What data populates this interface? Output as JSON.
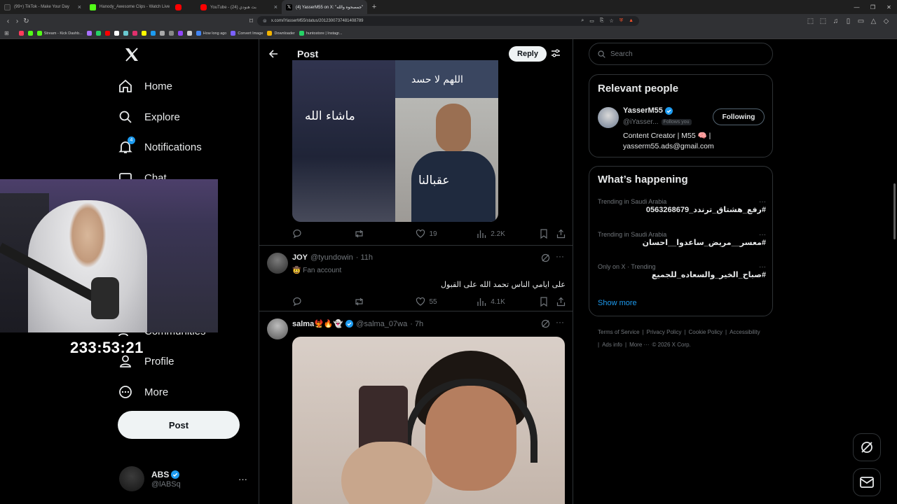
{
  "browser": {
    "tabs": [
      {
        "title": "(99+) TikTok - Make Your Day",
        "color": "#2b2b2b"
      },
      {
        "title": "Hanody_Awesome Clips - Watch Live",
        "color": "#53fc18"
      },
      {
        "title": "",
        "color": "#ff0000"
      },
      {
        "title": "YouTube - (24) بث هنودي",
        "color": "#ff0000"
      },
      {
        "title": "(4) YasserM55 on X: \"جمصحوه والله\"",
        "color": "#000000",
        "active": true
      }
    ],
    "new_tab": "+",
    "url": "x.com/iYasserM55/status/2012300737481408789",
    "bookmarks": [
      {
        "label": "",
        "color": "#ff3b5c"
      },
      {
        "label": "",
        "color": "#53fc18"
      },
      {
        "label": "Stream - Kick Dashb...",
        "color": "#53fc18"
      },
      {
        "label": "",
        "color": "#a970ff"
      },
      {
        "label": "",
        "color": "#25d366"
      },
      {
        "label": "",
        "color": "#ff0000"
      },
      {
        "label": "",
        "color": "#ffffff"
      },
      {
        "label": "",
        "color": "#69c9d0"
      },
      {
        "label": "",
        "color": "#e1306c"
      },
      {
        "label": "",
        "color": "#fffc00"
      },
      {
        "label": "",
        "color": "#1d9bf0"
      },
      {
        "label": "",
        "color": "#aaaaaa"
      },
      {
        "label": "",
        "color": "#888888"
      },
      {
        "label": "",
        "color": "#9146ff"
      },
      {
        "label": "",
        "color": "#cccccc"
      },
      {
        "label": "How long ago",
        "color": "#4285f4"
      },
      {
        "label": "Convert Image",
        "color": "#7b61ff"
      },
      {
        "label": "Downloader",
        "color": "#f4b400"
      },
      {
        "label": "huntostore | Instagr...",
        "color": "#25d366"
      }
    ]
  },
  "sidebar": {
    "nav": [
      {
        "label": "Home",
        "icon": "home-icon"
      },
      {
        "label": "Explore",
        "icon": "search-icon"
      },
      {
        "label": "Notifications",
        "icon": "bell-icon",
        "badge": "4"
      },
      {
        "label": "Chat",
        "icon": "chat-icon"
      },
      {
        "label": "Communities",
        "icon": "communities-icon"
      },
      {
        "label": "Profile",
        "icon": "profile-icon"
      },
      {
        "label": "More",
        "icon": "more-circle-icon"
      }
    ],
    "post_label": "Post",
    "account": {
      "name": "ABS",
      "handle": "@lABSq",
      "more": "···"
    }
  },
  "stream_overlay": {
    "timer": "233:53:21"
  },
  "main": {
    "header_title": "Post",
    "reply_label": "Reply",
    "image1": {
      "top_text": "اللهم لا حسد",
      "left_text": "ماشاء الله",
      "bottom_text": "عقبالنا"
    },
    "post_stats": {
      "replies": "",
      "reposts": "",
      "likes": "19",
      "views": "2.2K"
    },
    "replies": [
      {
        "name": "JOY",
        "handle": "@tyundowin",
        "time": "· 11h",
        "badge_text": "🤠 Fan account",
        "text": "على ايامي الناس تحمد الله على القبول",
        "stats": {
          "replies": "",
          "reposts": "",
          "likes": "55",
          "views": "4.1K"
        }
      },
      {
        "name": "salma🐦‍🔥🔥👻",
        "handle": "@salma_07wa",
        "time": "· 7h"
      }
    ]
  },
  "right": {
    "search_placeholder": "Search",
    "relevant_title": "Relevant people",
    "person": {
      "name": "YasserM55",
      "handle": "@iYasser...",
      "follows_you": "Follows you",
      "follow_label": "Following",
      "bio": "Content Creator | M55 🧠 | yasserm55.ads@gmail.com"
    },
    "happening_title": "What’s happening",
    "trends": [
      {
        "category": "Trending in Saudi Arabia",
        "tag": "#رفع_هشتاق_ترندد_0563268679"
      },
      {
        "category": "Trending in Saudi Arabia",
        "tag": "#معسر__مريض_ساعدوا__احسان"
      },
      {
        "category": "Only on X · Trending",
        "tag": "#صباح_الخير_والسعاده_للجميع"
      }
    ],
    "show_more": "Show more",
    "footer": [
      "Terms of Service",
      "|",
      "Privacy Policy",
      "|",
      "Cookie Policy",
      "|",
      "Accessibility",
      "|",
      "Ads info",
      "|",
      "More ···",
      "© 2026 X Corp."
    ]
  },
  "colors": {
    "accent": "#1d9bf0",
    "background": "#000000",
    "border": "#2f3336",
    "muted": "#71767b"
  }
}
